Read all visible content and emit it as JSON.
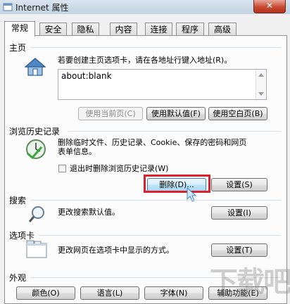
{
  "window": {
    "title": "Internet 属性",
    "close_glyph": "✕"
  },
  "tabs": [
    {
      "label": "常规",
      "active": true
    },
    {
      "label": "安全"
    },
    {
      "label": "隐私"
    },
    {
      "label": "内容"
    },
    {
      "label": "连接"
    },
    {
      "label": "程序"
    },
    {
      "label": "高级"
    }
  ],
  "home": {
    "section_label": "主页",
    "description": "若要创建主页选项卡，请在各地址行键入地址(R)。",
    "address_value": "about:blank",
    "buttons": {
      "use_current": "使用当前页(C)",
      "use_default": "使用默认值(F)",
      "use_blank": "使用空白页(B)"
    }
  },
  "history": {
    "section_label": "浏览历史记录",
    "description_line1": "删除临时文件、历史记录、Cookie、保存的密码和网页",
    "description_line2": "表单信息。",
    "checkbox_label": "退出时删除浏览历史记录(W)",
    "checkbox_checked": false,
    "buttons": {
      "delete": "删除(D)...",
      "settings": "设置(S)"
    }
  },
  "search": {
    "section_label": "搜索",
    "description": "更改搜索默认值。",
    "settings_button": "设置(I)"
  },
  "tabs_section": {
    "section_label": "选项卡",
    "description": "更改网页在选项卡中显示的方式。",
    "settings_button": "设置(T)"
  },
  "appearance": {
    "section_label": "外观",
    "buttons": {
      "colors": "颜色(O)",
      "languages": "语言(L)",
      "fonts": "字体(N)",
      "accessibility": "辅助功能(E)"
    }
  },
  "watermark": "下载吧",
  "colors": {
    "highlight": "#d8222d",
    "titlebar": "#c3d3e2",
    "panel": "#fcfcfc"
  }
}
